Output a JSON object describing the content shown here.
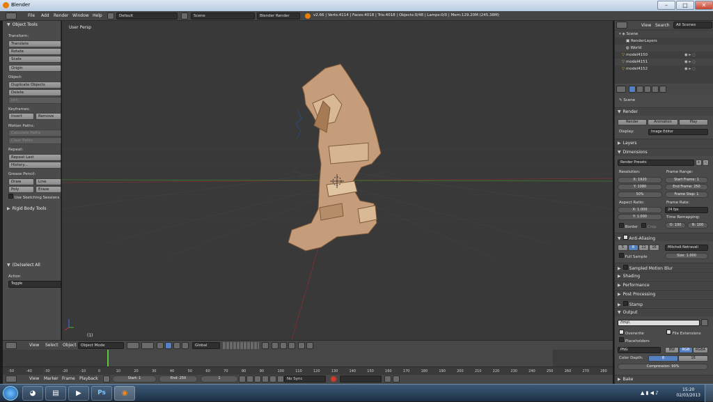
{
  "window": {
    "title": "Blender"
  },
  "info_header": {
    "menus": [
      "File",
      "Add",
      "Render",
      "Window",
      "Help"
    ],
    "layout": "Default",
    "scene": "Scene",
    "engine": "Blender Render",
    "stats": "v2.66 | Verts:4114 | Faces:4018 | Tris:4018 | Objects:0/48 | Lamps:0/0 | Mem:129.20M (245.38M)"
  },
  "toolshelf": {
    "title": "Object Tools",
    "transform_label": "Transform:",
    "translate": "Translate",
    "rotate": "Rotate",
    "scale": "Scale",
    "origin": "Origin",
    "object_label": "Object:",
    "duplicate": "Duplicate Objects",
    "delete": "Delete",
    "join": "Join",
    "keyframes_label": "Keyframes:",
    "insert": "Insert",
    "remove": "Remove",
    "motion_label": "Motion Paths:",
    "calc_paths": "Calculate Paths",
    "clear_paths": "Clear Paths",
    "repeat_label": "Repeat:",
    "repeat_last": "Repeat Last",
    "history": "History...",
    "grease_label": "Grease Pencil:",
    "draw": "Draw",
    "line": "Line",
    "poly": "Poly",
    "erase": "Erase",
    "sketch": "Use Sketching Sessions",
    "rigid": "Rigid Body Tools",
    "op_title": "(De)select All",
    "action_label": "Action",
    "action_value": "Toggle"
  },
  "viewport": {
    "label": "User Persp",
    "frame": "(1)"
  },
  "view3d_header": {
    "menus": [
      "View",
      "Select",
      "Object"
    ],
    "mode": "Object Mode",
    "orientation": "Global"
  },
  "timeline": {
    "ticks": [
      "-50",
      "-40",
      "-30",
      "-20",
      "-10",
      "0",
      "10",
      "20",
      "30",
      "40",
      "50",
      "60",
      "70",
      "80",
      "90",
      "100",
      "110",
      "120",
      "130",
      "140",
      "150",
      "160",
      "170",
      "180",
      "190",
      "200",
      "210",
      "220",
      "230",
      "240",
      "250",
      "260",
      "270",
      "280"
    ],
    "current_frame": 1
  },
  "timeline_header": {
    "menus": [
      "View",
      "Marker",
      "Frame",
      "Playback"
    ],
    "start": "Start: 1",
    "end": "End: 250",
    "current": "1",
    "sync": "No Sync"
  },
  "outliner": {
    "menus": [
      "View",
      "Search"
    ],
    "filter": "All Scenes",
    "rows": [
      "Scene",
      "RenderLayers",
      "World",
      "model4150",
      "model4151",
      "model4152"
    ]
  },
  "properties": {
    "context": "Scene",
    "render_panel": "Render",
    "render_btn": "Render",
    "animation_btn": "Animation",
    "play_btn": "Play",
    "display_label": "Display:",
    "display_value": "Image Editor",
    "layers": "Layers",
    "dimensions": "Dimensions",
    "render_presets": "Render Presets",
    "resolution_label": "Resolution:",
    "res_x": "X: 1920",
    "res_y": "Y: 1080",
    "res_pct": "50%",
    "frame_range_label": "Frame Range:",
    "start_frame": "Start Frame: 1",
    "end_frame": "End Frame: 250",
    "frame_step": "Frame Step: 1",
    "aspect_label": "Aspect Ratio:",
    "aspect_x": "X: 1.000",
    "aspect_y": "Y: 1.000",
    "frame_rate_label": "Frame Rate:",
    "fps": "24 fps",
    "remap_label": "Time Remapping:",
    "remap_old": "O: 100",
    "remap_new": "N: 100",
    "border": "Border",
    "crop": "Crop",
    "aa": "Anti-Aliasing",
    "aa_samples": [
      "5",
      "8",
      "11",
      "16"
    ],
    "aa_filter": "Mitchell-Netravali",
    "full_sample": "Full Sample",
    "size": "Size: 1.000",
    "motion_blur": "Sampled Motion Blur",
    "shading": "Shading",
    "performance": "Performance",
    "post_processing": "Post Processing",
    "stamp": "Stamp",
    "output": "Output",
    "output_path": "/tmp\\",
    "overwrite": "Overwrite",
    "file_ext": "File Extensions",
    "placeholders": "Placeholders",
    "format": "PNG",
    "color_modes": [
      "BW",
      "RGB",
      "RGBA"
    ],
    "color_depth_label": "Color Depth:",
    "depths": [
      "8",
      "16"
    ],
    "compression": "Compression: 90%",
    "bake": "Bake"
  },
  "taskbar": {
    "time": "15:20",
    "date": "02/03/2013",
    "apps": [
      "start-orb",
      "chrome",
      "explorer",
      "media-player",
      "photoshop",
      "blender"
    ]
  }
}
